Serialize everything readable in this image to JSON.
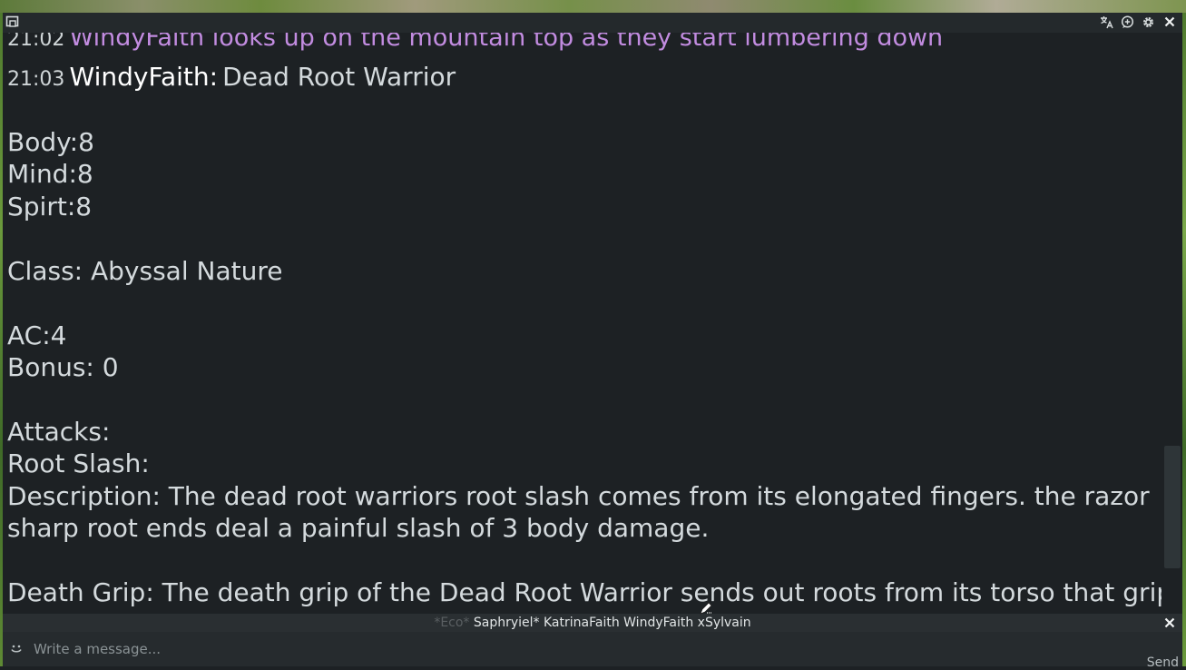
{
  "titlebar": {
    "icons": [
      "popout-icon",
      "translate-icon",
      "chat-bubble-icon",
      "gear-icon",
      "close-icon"
    ]
  },
  "chat": {
    "messages": [
      {
        "time": "21:02",
        "emote": "WindyFaith looks up on the mountain top as they start lumbering down"
      },
      {
        "time": "21:03",
        "speaker": "WindyFaith:",
        "text": "Dead Root Warrior"
      }
    ],
    "body_lines": [
      "",
      "Body:8",
      "Mind:8",
      "Spirt:8",
      "",
      "Class: Abyssal Nature",
      "",
      "AC:4",
      "Bonus: 0",
      "",
      "Attacks:",
      "Root Slash:",
      "Description: The dead root warriors root slash comes from its elongated fingers. the razor",
      "sharp root ends deal a painful slash of 3 body damage.",
      "",
      "Death Grip: The death grip of the Dead Root Warrior sends out roots from its torso that grips"
    ]
  },
  "typing": {
    "eco": "*Eco*",
    "users": "Saphryiel* KatrinaFaith WindyFaith xSylvain"
  },
  "input": {
    "placeholder": "Write a message...",
    "send_label": "Send"
  },
  "colors": {
    "emote": "#c28ce0",
    "background": "#1d2124",
    "text": "#d4dadd"
  }
}
